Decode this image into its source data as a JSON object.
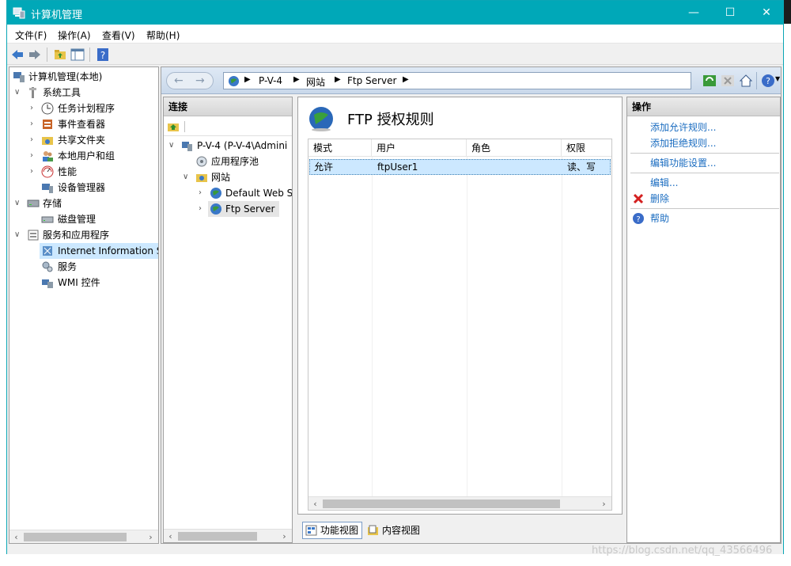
{
  "window": {
    "title": "计算机管理"
  },
  "menu": [
    "文件(F)",
    "操作(A)",
    "查看(V)",
    "帮助(H)"
  ],
  "tree": {
    "root": "计算机管理(本地)",
    "system_tools": "系统工具",
    "task_scheduler": "任务计划程序",
    "event_viewer": "事件查看器",
    "shared_folders": "共享文件夹",
    "local_users": "本地用户和组",
    "performance": "性能",
    "device_manager": "设备管理器",
    "storage": "存储",
    "disk_management": "磁盘管理",
    "services_apps": "服务和应用程序",
    "iis": "Internet Information S",
    "services": "服务",
    "wmi": "WMI 控件"
  },
  "address": {
    "crumbs": [
      "P-V-4",
      "网站",
      "Ftp Server"
    ]
  },
  "connections": {
    "header": "连接",
    "server": "P-V-4 (P-V-4\\Admini",
    "app_pools": "应用程序池",
    "sites": "网站",
    "default_site": "Default Web S",
    "ftp_site": "Ftp Server"
  },
  "feature": {
    "title": "FTP 授权规则",
    "columns": [
      "模式",
      "用户",
      "角色",
      "权限"
    ],
    "rows": [
      {
        "mode": "允许",
        "user": "ftpUser1",
        "role": "",
        "perm": "读、写"
      }
    ]
  },
  "view_tabs": {
    "features": "功能视图",
    "content": "内容视图"
  },
  "actions": {
    "header": "操作",
    "add_allow": "添加允许规则...",
    "add_deny": "添加拒绝规则...",
    "edit_settings": "编辑功能设置...",
    "edit": "编辑...",
    "delete": "删除",
    "help": "帮助"
  },
  "watermark": "https://blog.csdn.net/qq_43566496"
}
